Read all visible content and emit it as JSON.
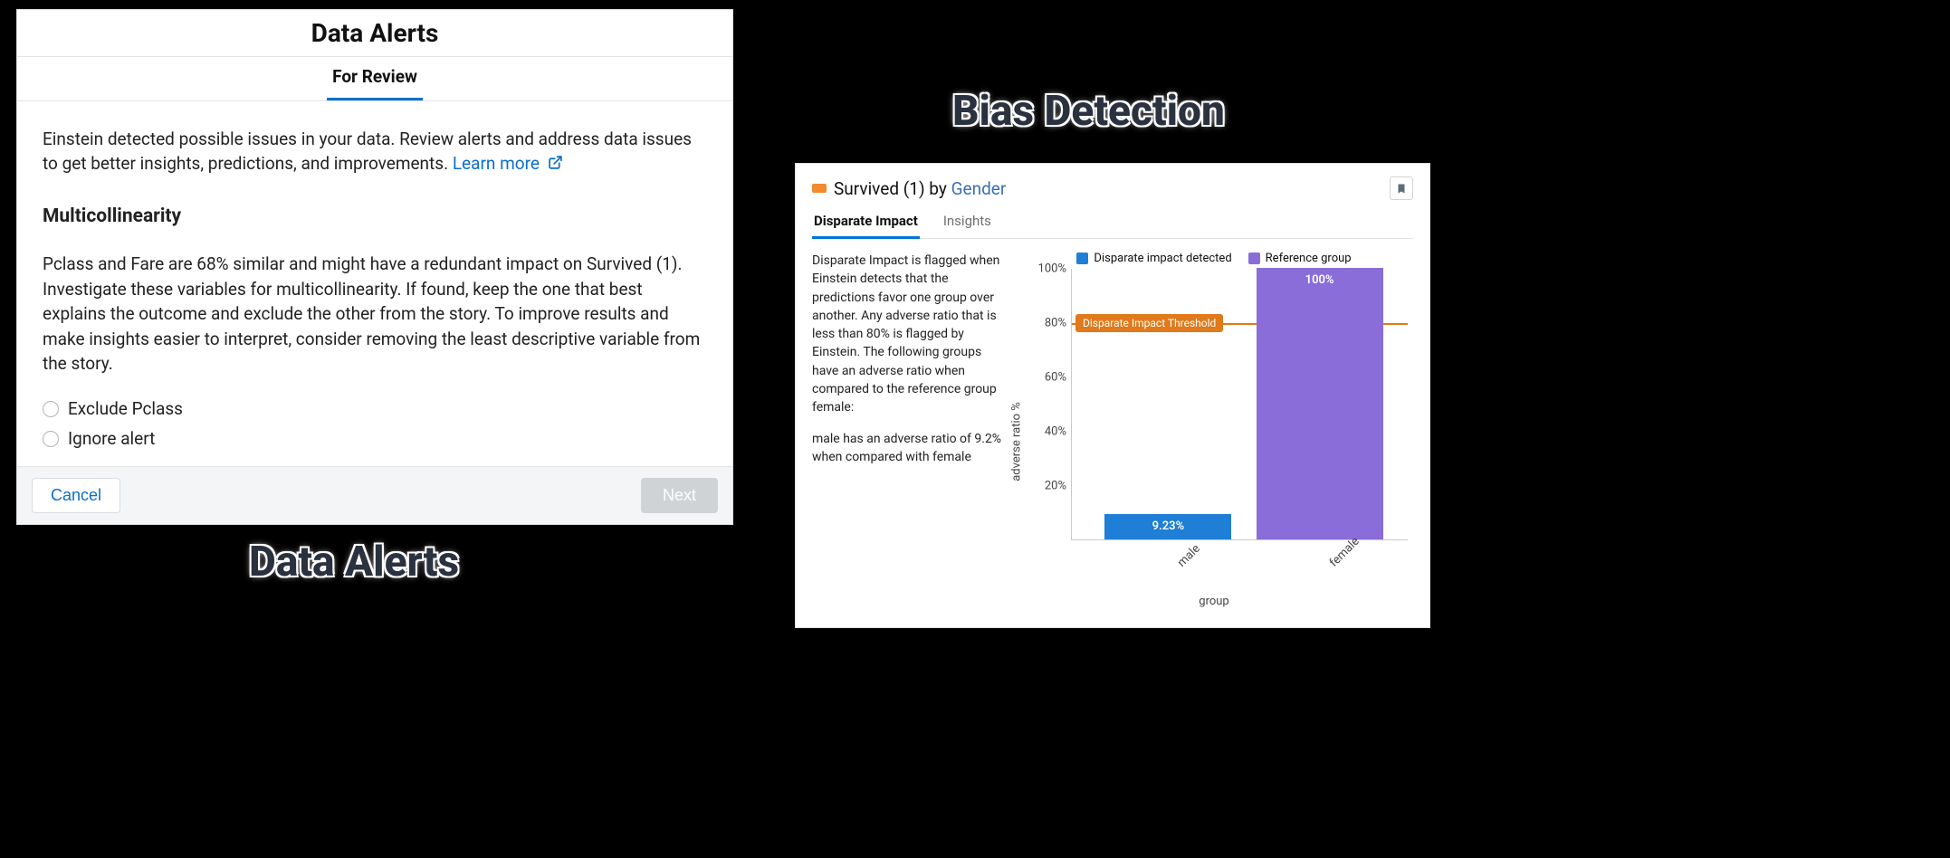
{
  "captions": {
    "left": "Data Alerts",
    "right": "Bias Detection"
  },
  "data_alerts": {
    "title": "Data Alerts",
    "tab": "For Review",
    "intro": "Einstein detected possible issues in your data. Review alerts and address data issues to get better insights, predictions, and improvements.",
    "learn_more": "Learn more",
    "section_title": "Multicollinearity",
    "description": "Pclass and Fare are 68% similar and might have a redundant impact on Survived (1). Investigate these variables for multicollinearity. If found, keep the one that best explains the outcome and exclude the other from the story. To improve results and make insights easier to interpret, consider removing the least descriptive variable from the story.",
    "options": [
      "Exclude Pclass",
      "Ignore alert"
    ],
    "cancel": "Cancel",
    "next": "Next"
  },
  "bias": {
    "title_prefix": "Survived (1) by ",
    "title_link": "Gender",
    "tabs": {
      "disparate": "Disparate Impact",
      "insights": "Insights"
    },
    "para1": "Disparate Impact is flagged when Einstein detects that the predictions favor one group over another. Any adverse ratio that is less than 80% is flagged by Einstein. The following groups have an adverse ratio when compared to the reference group female:",
    "para2": "male has an adverse ratio of 9.2% when compared with female",
    "legend": {
      "detected": "Disparate impact detected",
      "reference": "Reference group"
    },
    "threshold_label": "Disparate Impact Threshold",
    "yaxis": "adverse ratio %",
    "xaxis": "group"
  },
  "chart_data": {
    "type": "bar",
    "title": "Survived (1) by Gender — Disparate Impact",
    "xlabel": "group",
    "ylabel": "adverse ratio %",
    "ylim": [
      0,
      100
    ],
    "yticks": [
      20,
      40,
      60,
      80,
      100
    ],
    "threshold": 80,
    "threshold_label": "Disparate Impact Threshold",
    "series": [
      {
        "name": "Disparate impact detected",
        "color": "#1f7ed6",
        "categories": [
          "male"
        ],
        "values": [
          9.23
        ],
        "value_labels": [
          "9.23%"
        ]
      },
      {
        "name": "Reference group",
        "color": "#8a6dd9",
        "categories": [
          "female"
        ],
        "values": [
          100
        ],
        "value_labels": [
          "100%"
        ]
      }
    ],
    "categories": [
      "male",
      "female"
    ]
  },
  "colors": {
    "detected": "#1f7ed6",
    "reference": "#8a6dd9",
    "threshold": "#e07a1b"
  }
}
